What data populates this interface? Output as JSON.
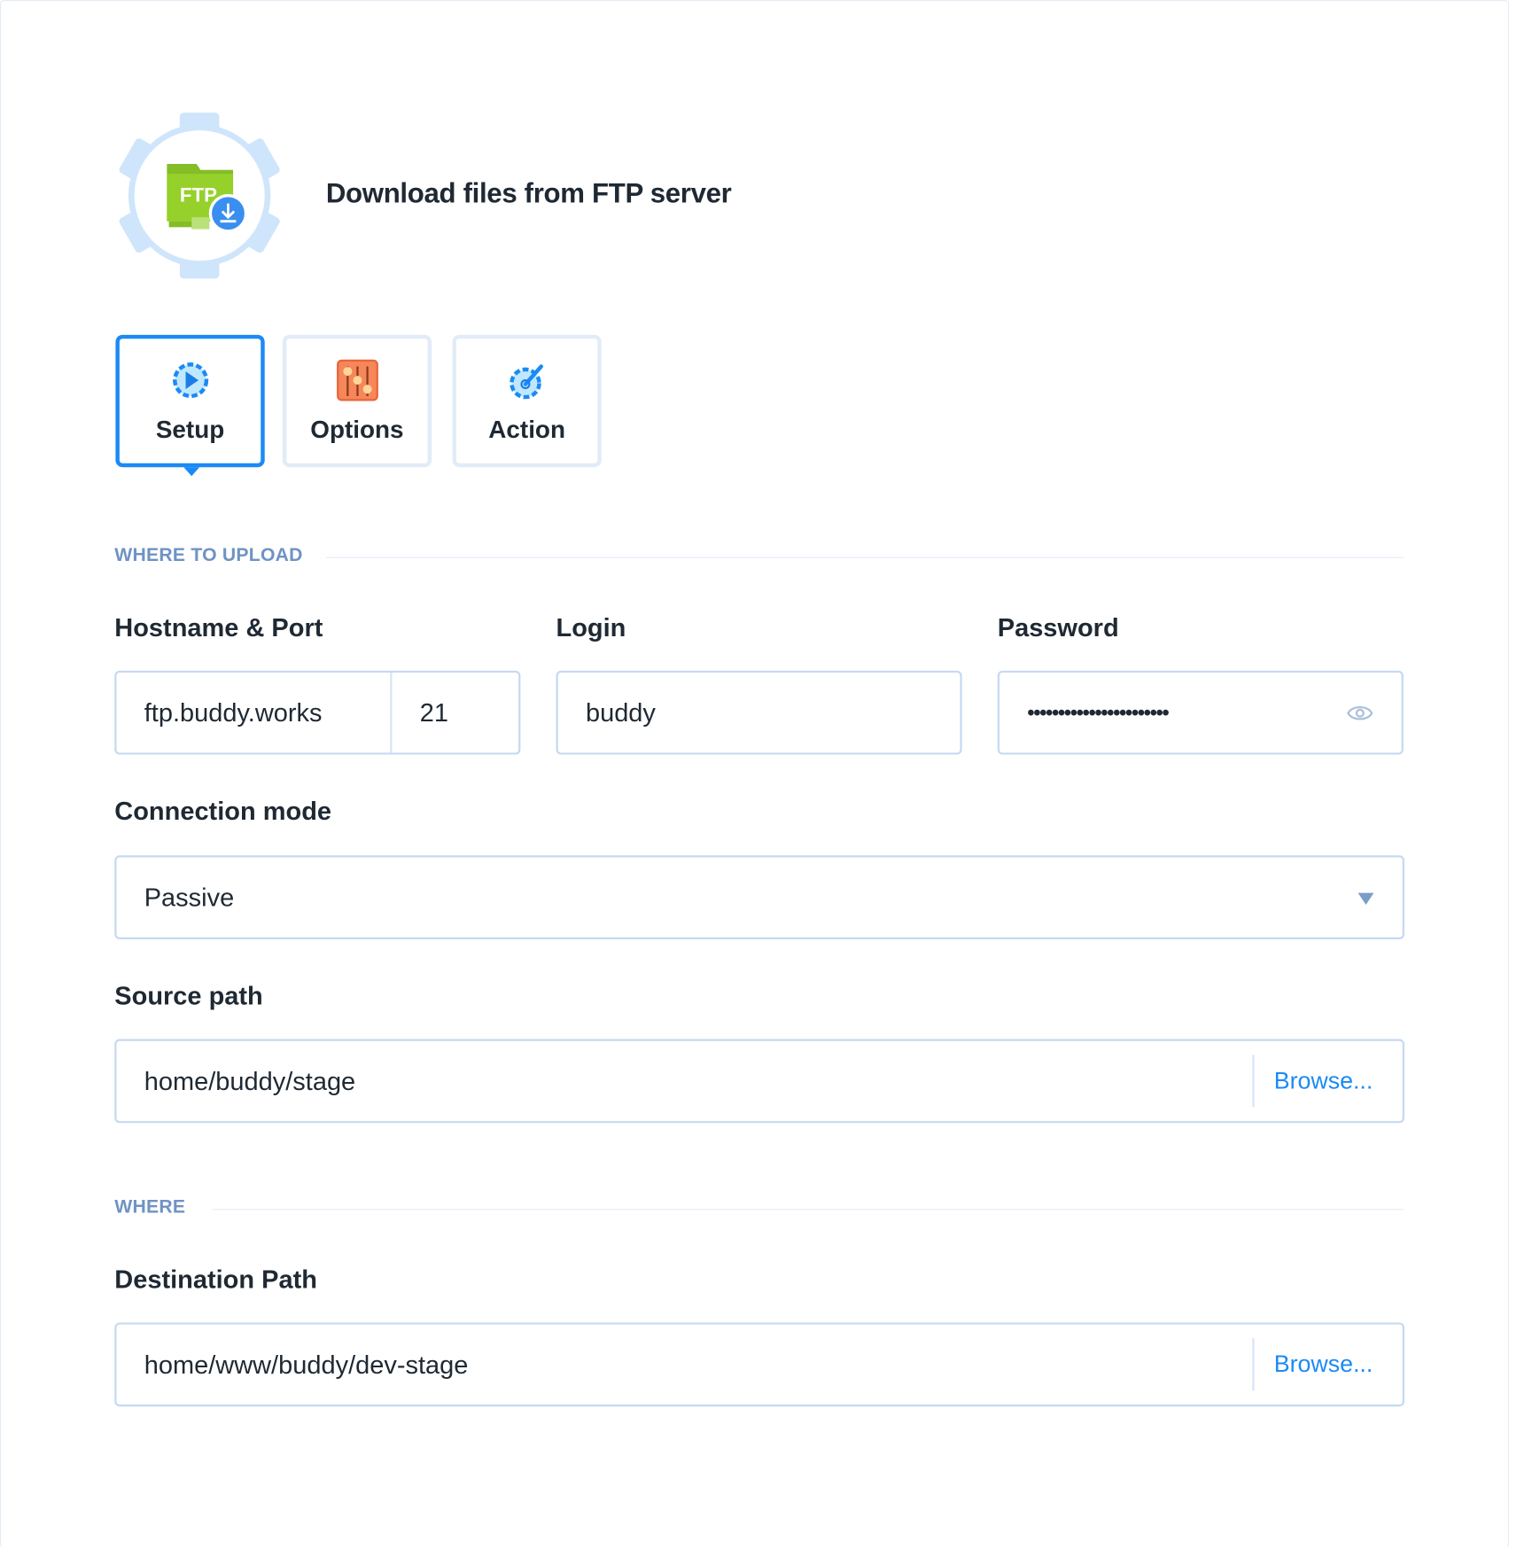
{
  "header": {
    "title": "Download files from FTP server",
    "logo_text": "FTP",
    "icon": "ftp-download-icon"
  },
  "tabs": [
    {
      "label": "Setup",
      "icon": "gear-play-icon",
      "active": true
    },
    {
      "label": "Options",
      "icon": "sliders-icon",
      "active": false
    },
    {
      "label": "Action",
      "icon": "gear-wrench-icon",
      "active": false
    }
  ],
  "sections": {
    "upload": "WHERE TO UPLOAD",
    "where": "WHERE"
  },
  "fields": {
    "hostname": {
      "label": "Hostname & Port",
      "host": "ftp.buddy.works",
      "port": "21"
    },
    "login": {
      "label": "Login",
      "value": "buddy"
    },
    "password": {
      "label": "Password",
      "value": "•••••••••••••••••••••••",
      "icon": "eye-icon"
    },
    "connection_mode": {
      "label": "Connection mode",
      "value": "Passive"
    },
    "source_path": {
      "label": "Source path",
      "value": "home/buddy/stage",
      "browse": "Browse..."
    },
    "destination_path": {
      "label": "Destination Path",
      "value": "home/www/buddy/dev-stage",
      "browse": "Browse..."
    }
  },
  "colors": {
    "accent": "#1b8af5",
    "section": "#6f93c3",
    "border": "#c5d9f2"
  }
}
